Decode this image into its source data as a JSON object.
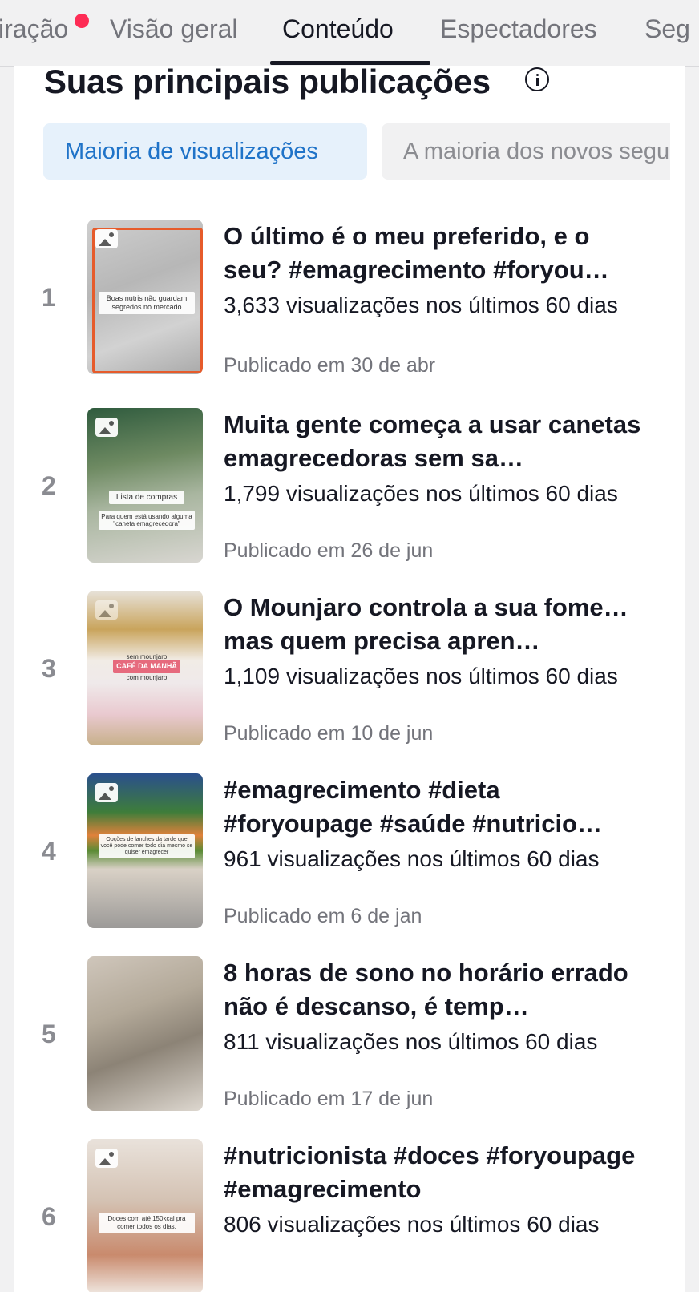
{
  "tabs": [
    {
      "label": "iração"
    },
    {
      "label": "Visão geral"
    },
    {
      "label": "Conteúdo"
    },
    {
      "label": "Espectadores"
    },
    {
      "label": "Seg"
    }
  ],
  "section": {
    "title": "Suas principais publicações"
  },
  "filters": [
    {
      "label": "Maioria de visualizações"
    },
    {
      "label": "A maioria dos novos seguidores"
    }
  ],
  "posts": [
    {
      "rank": "1",
      "title": "O último é o meu preferido, e o seu?  #emagrecimento #foryou…",
      "views": "3,633 visualizações nos últimos 60 dias",
      "date": "Publicado em 30 de abr",
      "thumb_caption": "Boas nutris não guardam segredos no mercado"
    },
    {
      "rank": "2",
      "title": "Muita gente começa a usar canetas emagrecedoras sem sa…",
      "views": "1,799 visualizações nos últimos 60 dias",
      "date": "Publicado em 26 de jun",
      "thumb_caption": "Lista de compras",
      "thumb_caption2": "Para quem está usando alguma \"caneta emagrecedora\""
    },
    {
      "rank": "3",
      "title": "O Mounjaro controla a sua fome… mas quem precisa apren…",
      "views": "1,109 visualizações nos últimos 60 dias",
      "date": "Publicado em 10 de jun",
      "thumb_caption": "sem mounjaro",
      "thumb_caption2": "CAFÉ DA MANHÃ",
      "thumb_caption3": "com mounjaro"
    },
    {
      "rank": "4",
      "title": "#emagrecimento #dieta #foryoupage #saúde #nutricio…",
      "views": "961 visualizações nos últimos 60 dias",
      "date": "Publicado em 6 de jan",
      "thumb_caption": "Opções de lanches da tarde que você pode comer todo dia mesmo se quiser emagrecer"
    },
    {
      "rank": "5",
      "title": "8 horas de sono no horário errado não é descanso, é temp…",
      "views": "811 visualizações nos últimos 60 dias",
      "date": "Publicado em 17 de jun"
    },
    {
      "rank": "6",
      "title": "#nutricionista #doces #foryoupage #emagrecimento",
      "views": "806 visualizações nos últimos 60 dias",
      "date": "",
      "thumb_caption": "Doces com até 150kcal pra comer todos os dias."
    }
  ]
}
